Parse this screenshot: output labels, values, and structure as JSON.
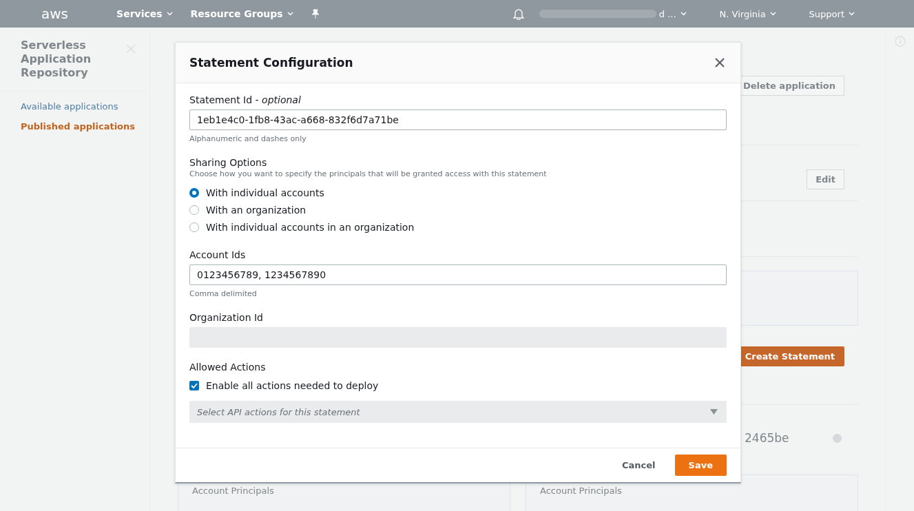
{
  "nav": {
    "logo": "aws",
    "menus": [
      {
        "label": "Services"
      },
      {
        "label": "Resource Groups"
      }
    ],
    "account": "d ...",
    "region": "N. Virginia",
    "support": "Support"
  },
  "sidebar": {
    "title": "Serverless Application Repository",
    "items": [
      {
        "label": "Available applications",
        "selected": false
      },
      {
        "label": "Published applications",
        "selected": true
      }
    ]
  },
  "main": {
    "delete_button": "Delete application",
    "edit_button": "Edit",
    "create_button": "Create Statement",
    "statement_id_fragment": "2465be",
    "cards": [
      {
        "title": "Account Principals"
      },
      {
        "title": "Account Principals"
      }
    ]
  },
  "dialog": {
    "title": "Statement Configuration",
    "statement_id": {
      "label": "Statement Id - *optional*",
      "value": "1eb1e4c0-1fb8-43ac-a668-832f6d7a71be",
      "hint": "Alphanumeric and dashes only"
    },
    "sharing": {
      "label": "Sharing Options",
      "description": "Choose how you want to specify the principals that will be granted access with this statement",
      "options": [
        {
          "label": "With individual accounts",
          "selected": true
        },
        {
          "label": "With an organization",
          "selected": false
        },
        {
          "label": "With individual accounts in an organization",
          "selected": false
        }
      ]
    },
    "account_ids": {
      "label": "Account Ids",
      "value": "0123456789, 1234567890",
      "hint": "Comma delimited",
      "disabled": false
    },
    "organization_id": {
      "label": "Organization Id",
      "disabled": true
    },
    "allowed_actions": {
      "label": "Allowed Actions",
      "checkbox": {
        "label": "Enable all actions needed to deploy",
        "checked": true
      },
      "select": {
        "placeholder": "Select API actions for this statement",
        "disabled": true
      }
    },
    "buttons": [
      {
        "label": "Cancel",
        "kind": "link"
      },
      {
        "label": "Save",
        "kind": "primary"
      }
    ]
  }
}
